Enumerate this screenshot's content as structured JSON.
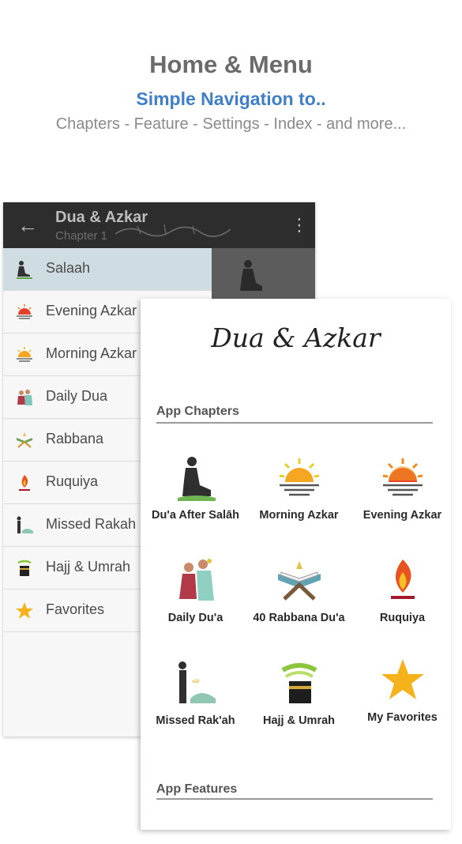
{
  "hero": {
    "title": "Home & Menu",
    "subtitle": "Simple Navigation to..",
    "description": "Chapters - Feature - Settings - Index - and more..."
  },
  "drawer_screen": {
    "toolbar": {
      "back_icon": "arrow-left-icon",
      "title": "Dua & Azkar",
      "subtitle": "Chapter 1",
      "more_icon": "more-vert-icon"
    },
    "items": [
      {
        "label": "Salaah",
        "icon": "praying-man-icon",
        "active": true
      },
      {
        "label": "Evening Azkar",
        "icon": "sunset-icon",
        "active": false
      },
      {
        "label": "Morning Azkar",
        "icon": "sunrise-icon",
        "active": false
      },
      {
        "label": "Daily Dua",
        "icon": "family-dua-icon",
        "active": false
      },
      {
        "label": "Rabbana",
        "icon": "quran-stand-icon",
        "active": false
      },
      {
        "label": "Ruquiya",
        "icon": "flame-icon",
        "active": false
      },
      {
        "label": "Missed Rakah",
        "icon": "prostration-icon",
        "active": false
      },
      {
        "label": "Hajj & Umrah",
        "icon": "kaaba-icon",
        "active": false
      },
      {
        "label": "Favorites",
        "icon": "star-icon",
        "active": false
      }
    ]
  },
  "home_screen": {
    "brand": "Dua & Azkar",
    "chapters_title": "App Chapters",
    "features_title": "App Features",
    "tiles": [
      {
        "label": "Du'a After Salāh",
        "icon": "praying-man-icon"
      },
      {
        "label": "Morning Azkar",
        "icon": "sunrise-icon"
      },
      {
        "label": "Evening Azkar",
        "icon": "sunset-icon"
      },
      {
        "label": "Daily Du'a",
        "icon": "family-dua-icon"
      },
      {
        "label": "40 Rabbana Du'a",
        "icon": "quran-stand-icon"
      },
      {
        "label": "Ruquiya",
        "icon": "flame-icon"
      },
      {
        "label": "Missed Rak'ah",
        "icon": "prostration-icon"
      },
      {
        "label": "Hajj & Umrah",
        "icon": "kaaba-icon"
      },
      {
        "label": "My Favorites",
        "icon": "star-icon"
      }
    ]
  },
  "colors": {
    "accent_blue": "#3f7fc9",
    "toolbar_dark": "#2d2d2d",
    "active_item": "#cfdde3",
    "star_gold": "#f5b21b",
    "sun_orange": "#f28b1e"
  }
}
